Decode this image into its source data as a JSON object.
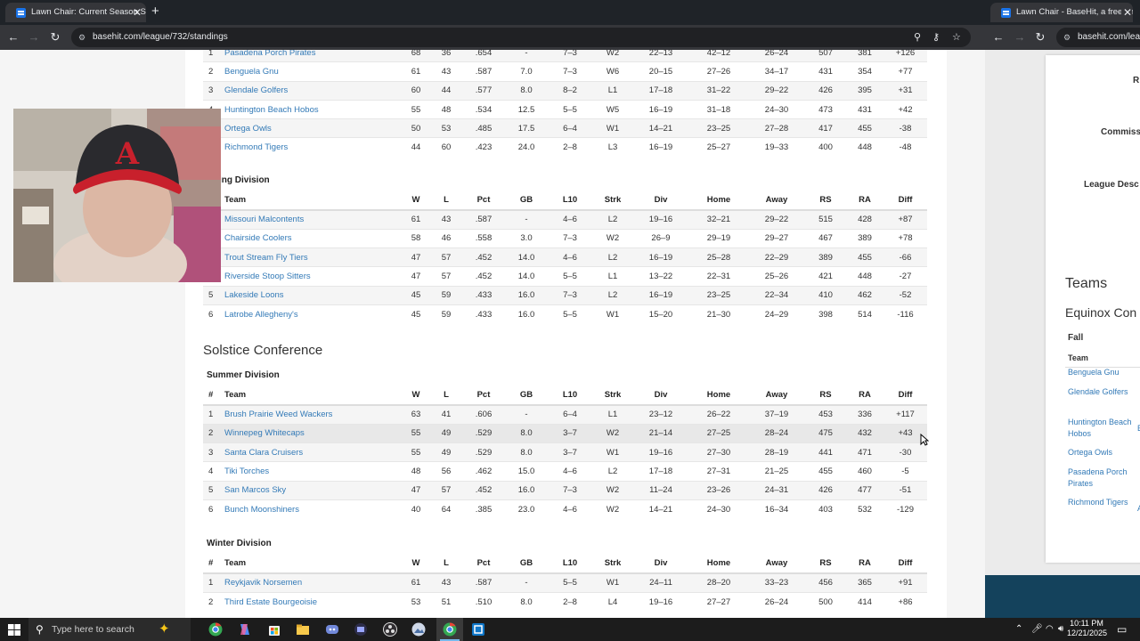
{
  "left_window": {
    "tab_title": "Lawn Chair: Current Season Sta",
    "new_tab_label": "+",
    "url": "basehit.com/league/732/standings",
    "partial_conference_rows": [
      {
        "num": "1",
        "team": "Pasadena Porch Pirates",
        "w": "68",
        "l": "36",
        "pct": ".654",
        "gb": "-",
        "l10": "7–3",
        "strk": "W2",
        "div": "22–13",
        "home": "42–12",
        "away": "26–24",
        "rs": "507",
        "ra": "381",
        "diff": "+126"
      },
      {
        "num": "2",
        "team": "Benguela Gnu",
        "w": "61",
        "l": "43",
        "pct": ".587",
        "gb": "7.0",
        "l10": "7–3",
        "strk": "W6",
        "div": "20–15",
        "home": "27–26",
        "away": "34–17",
        "rs": "431",
        "ra": "354",
        "diff": "+77"
      },
      {
        "num": "3",
        "team": "Glendale Golfers",
        "w": "60",
        "l": "44",
        "pct": ".577",
        "gb": "8.0",
        "l10": "8–2",
        "strk": "L1",
        "div": "17–18",
        "home": "31–22",
        "away": "29–22",
        "rs": "426",
        "ra": "395",
        "diff": "+31"
      },
      {
        "num": "4",
        "team": "Huntington Beach Hobos",
        "w": "55",
        "l": "48",
        "pct": ".534",
        "gb": "12.5",
        "l10": "5–5",
        "strk": "W5",
        "div": "16–19",
        "home": "31–18",
        "away": "24–30",
        "rs": "473",
        "ra": "431",
        "diff": "+42"
      },
      {
        "num": "5",
        "team": "Ortega Owls",
        "w": "50",
        "l": "53",
        "pct": ".485",
        "gb": "17.5",
        "l10": "6–4",
        "strk": "W1",
        "div": "14–21",
        "home": "23–25",
        "away": "27–28",
        "rs": "417",
        "ra": "455",
        "diff": "-38"
      },
      {
        "num": "6",
        "team": "Richmond Tigers",
        "w": "44",
        "l": "60",
        "pct": ".423",
        "gb": "24.0",
        "l10": "2–8",
        "strk": "L3",
        "div": "16–19",
        "home": "25–27",
        "away": "19–33",
        "rs": "400",
        "ra": "448",
        "diff": "-48"
      }
    ],
    "spring_division": {
      "title": "ing Division",
      "rows": [
        {
          "num": "1",
          "team": "Missouri Malcontents",
          "w": "61",
          "l": "43",
          "pct": ".587",
          "gb": "-",
          "l10": "4–6",
          "strk": "L2",
          "div": "19–16",
          "home": "32–21",
          "away": "29–22",
          "rs": "515",
          "ra": "428",
          "diff": "+87"
        },
        {
          "num": "2",
          "team": "Chairside Coolers",
          "w": "58",
          "l": "46",
          "pct": ".558",
          "gb": "3.0",
          "l10": "7–3",
          "strk": "W2",
          "div": "26–9",
          "home": "29–19",
          "away": "29–27",
          "rs": "467",
          "ra": "389",
          "diff": "+78"
        },
        {
          "num": "3",
          "team": "Trout Stream Fly Tiers",
          "w": "47",
          "l": "57",
          "pct": ".452",
          "gb": "14.0",
          "l10": "4–6",
          "strk": "L2",
          "div": "16–19",
          "home": "25–28",
          "away": "22–29",
          "rs": "389",
          "ra": "455",
          "diff": "-66"
        },
        {
          "num": "4",
          "team": "Riverside Stoop Sitters",
          "w": "47",
          "l": "57",
          "pct": ".452",
          "gb": "14.0",
          "l10": "5–5",
          "strk": "L1",
          "div": "13–22",
          "home": "22–31",
          "away": "25–26",
          "rs": "421",
          "ra": "448",
          "diff": "-27"
        },
        {
          "num": "5",
          "team": "Lakeside Loons",
          "w": "45",
          "l": "59",
          "pct": ".433",
          "gb": "16.0",
          "l10": "7–3",
          "strk": "L2",
          "div": "16–19",
          "home": "23–25",
          "away": "22–34",
          "rs": "410",
          "ra": "462",
          "diff": "-52"
        },
        {
          "num": "6",
          "team": "Latrobe Allegheny's",
          "w": "45",
          "l": "59",
          "pct": ".433",
          "gb": "16.0",
          "l10": "5–5",
          "strk": "W1",
          "div": "15–20",
          "home": "21–30",
          "away": "24–29",
          "rs": "398",
          "ra": "514",
          "diff": "-116"
        }
      ]
    },
    "solstice": {
      "title": "Solstice Conference",
      "summer": {
        "title": "Summer Division",
        "rows": [
          {
            "num": "1",
            "team": "Brush Prairie Weed Wackers",
            "w": "63",
            "l": "41",
            "pct": ".606",
            "gb": "-",
            "l10": "6–4",
            "strk": "L1",
            "div": "23–12",
            "home": "26–22",
            "away": "37–19",
            "rs": "453",
            "ra": "336",
            "diff": "+117"
          },
          {
            "num": "2",
            "team": "Winnepeg Whitecaps",
            "w": "55",
            "l": "49",
            "pct": ".529",
            "gb": "8.0",
            "l10": "3–7",
            "strk": "W2",
            "div": "21–14",
            "home": "27–25",
            "away": "28–24",
            "rs": "475",
            "ra": "432",
            "diff": "+43"
          },
          {
            "num": "3",
            "team": "Santa Clara Cruisers",
            "w": "55",
            "l": "49",
            "pct": ".529",
            "gb": "8.0",
            "l10": "3–7",
            "strk": "W1",
            "div": "19–16",
            "home": "27–30",
            "away": "28–19",
            "rs": "441",
            "ra": "471",
            "diff": "-30"
          },
          {
            "num": "4",
            "team": "Tiki Torches",
            "w": "48",
            "l": "56",
            "pct": ".462",
            "gb": "15.0",
            "l10": "4–6",
            "strk": "L2",
            "div": "17–18",
            "home": "27–31",
            "away": "21–25",
            "rs": "455",
            "ra": "460",
            "diff": "-5"
          },
          {
            "num": "5",
            "team": "San Marcos Sky",
            "w": "47",
            "l": "57",
            "pct": ".452",
            "gb": "16.0",
            "l10": "7–3",
            "strk": "W2",
            "div": "11–24",
            "home": "23–26",
            "away": "24–31",
            "rs": "426",
            "ra": "477",
            "diff": "-51"
          },
          {
            "num": "6",
            "team": "Bunch Moonshiners",
            "w": "40",
            "l": "64",
            "pct": ".385",
            "gb": "23.0",
            "l10": "4–6",
            "strk": "W2",
            "div": "14–21",
            "home": "24–30",
            "away": "16–34",
            "rs": "403",
            "ra": "532",
            "diff": "-129"
          }
        ]
      },
      "winter": {
        "title": "Winter Division",
        "rows": [
          {
            "num": "1",
            "team": "Reykjavik Norsemen",
            "w": "61",
            "l": "43",
            "pct": ".587",
            "gb": "-",
            "l10": "5–5",
            "strk": "W1",
            "div": "24–11",
            "home": "28–20",
            "away": "33–23",
            "rs": "456",
            "ra": "365",
            "diff": "+91"
          },
          {
            "num": "2",
            "team": "Third Estate Bourgeoisie",
            "w": "53",
            "l": "51",
            "pct": ".510",
            "gb": "8.0",
            "l10": "2–8",
            "strk": "L4",
            "div": "19–16",
            "home": "27–27",
            "away": "26–24",
            "rs": "500",
            "ra": "414",
            "diff": "+86"
          }
        ]
      }
    },
    "columns": {
      "num": "#",
      "team": "Team",
      "w": "W",
      "l": "L",
      "pct": "Pct",
      "gb": "GB",
      "l10": "L10",
      "strk": "Strk",
      "div": "Div",
      "home": "Home",
      "away": "Away",
      "rs": "RS",
      "ra": "RA",
      "diff": "Diff"
    }
  },
  "right_window": {
    "tab_title": "Lawn Chair - BaseHit, a free sim",
    "url": "basehit.com/leag",
    "labels": {
      "r": "R",
      "commissioner": "Commiss",
      "league_desc": "League Desc"
    },
    "teams_heading": "Teams",
    "conference_heading": "Equinox Con",
    "division": "Fall",
    "team_column": "Team",
    "teams": [
      "Benguela Gnu",
      "Glendale Golfers",
      "Huntington Beach Hobos",
      "Ortega Owls",
      "Pasadena Porch Pirates",
      "Richmond Tigers"
    ],
    "edge_letters": {
      "huntington": "E",
      "richmond": "A"
    }
  },
  "taskbar": {
    "search_placeholder": "Type here to search",
    "time": "10:11 PM",
    "date": "12/21/2025"
  },
  "colors": {
    "link": "#337ab7",
    "titlebar": "#1f2328",
    "toolbar": "#35363a",
    "taskbar": "#1c1c1c",
    "right_footer": "#14425c"
  }
}
